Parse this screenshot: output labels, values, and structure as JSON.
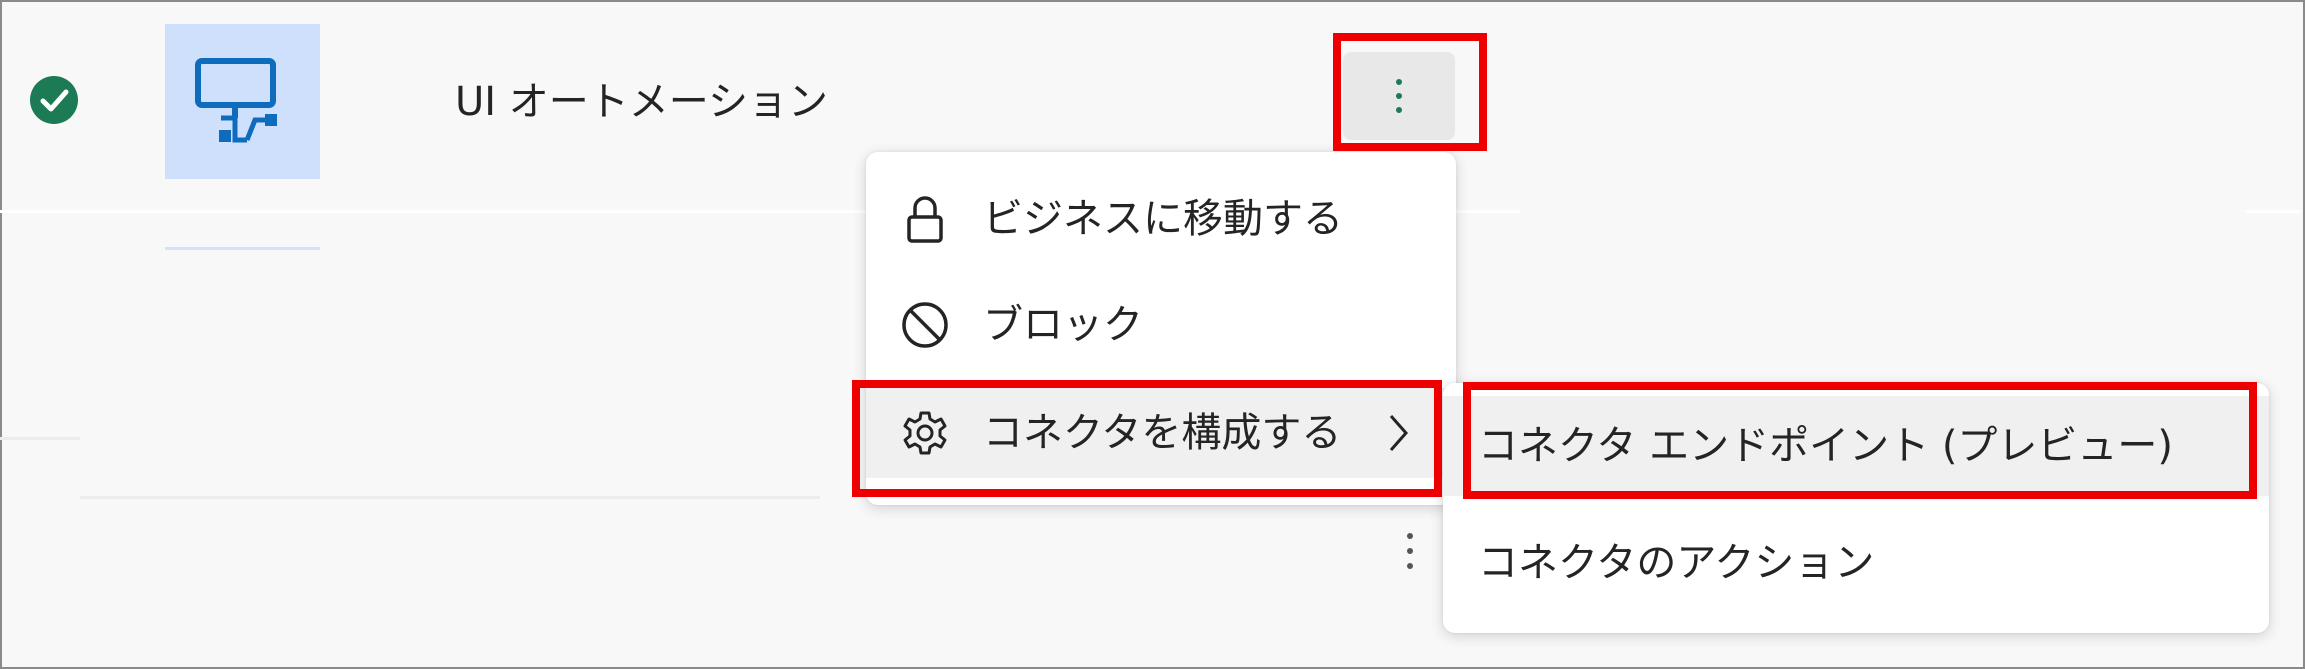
{
  "connector": {
    "name": "UI オートメーション",
    "status_icon": "checkmark-circle-icon",
    "tile_icon": "desktop-flow-icon",
    "more_icon": "more-vertical-icon"
  },
  "menu": {
    "items": [
      {
        "label": "ビジネスに移動する",
        "icon": "lock-icon"
      },
      {
        "label": "ブロック",
        "icon": "block-icon"
      },
      {
        "label": "コネクタを構成する",
        "icon": "gear-icon",
        "has_submenu": true
      }
    ]
  },
  "submenu": {
    "items": [
      {
        "label": "コネクタ エンドポイント (プレビュー)"
      },
      {
        "label": "コネクタのアクション"
      }
    ]
  },
  "colors": {
    "highlight": "#ee0000",
    "status": "#1c7a55",
    "tile_bg": "#cfe0fd",
    "tile_icon": "#0f6cbd"
  }
}
